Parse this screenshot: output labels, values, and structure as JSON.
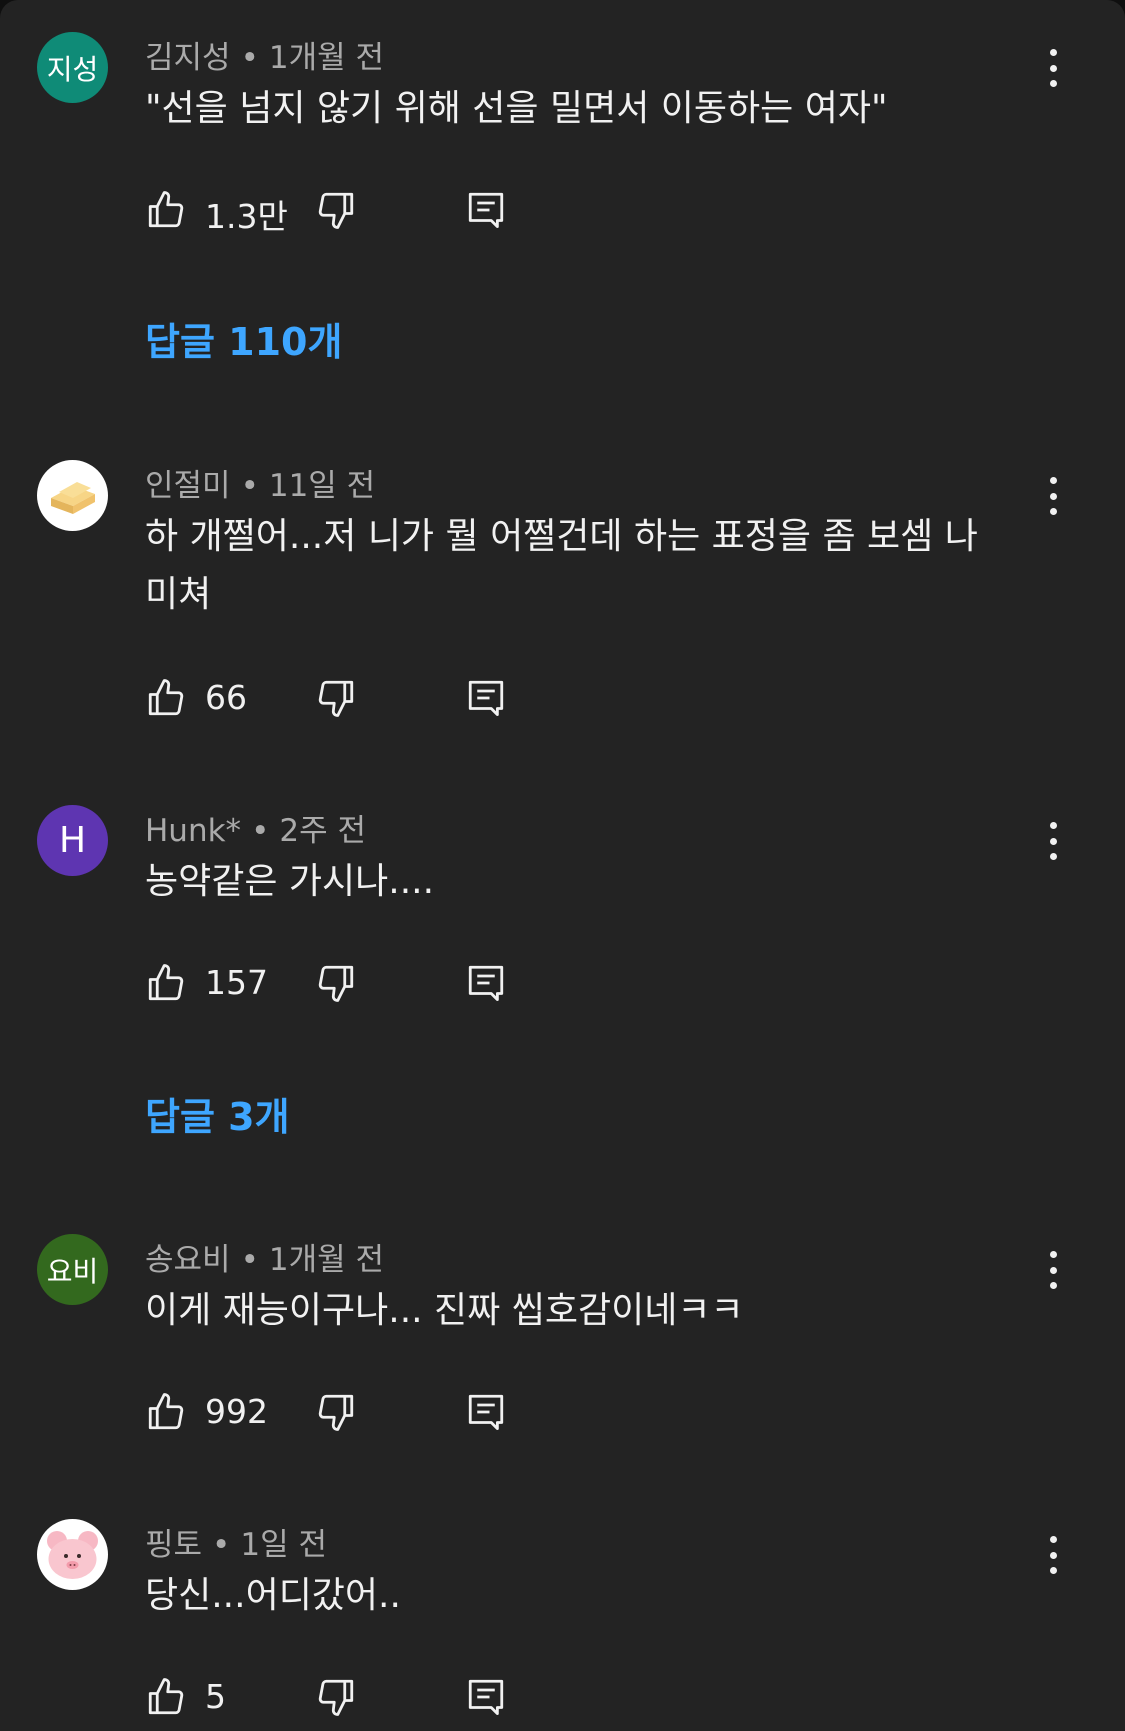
{
  "colors": {
    "background": "#232323",
    "text": "#f1f1f1",
    "meta": "#aaaaaa",
    "link": "#3ea6ff"
  },
  "comments": [
    {
      "avatar": {
        "text": "지성",
        "color": "#0f8b77"
      },
      "author": "김지성",
      "time": "1개월 전",
      "text": "\"선을 넘지 않기 위해 선을 밀면서 이동하는 여자\"",
      "likes": "1.3만",
      "replies": "답글 110개"
    },
    {
      "avatar": {
        "text": "",
        "icon": "cheese-icon",
        "color": "#ffffff"
      },
      "author": "인절미",
      "time": "11일 전",
      "text": "하 개쩔어...저 니가 뭘 어쩔건데 하는 표정을 좀 보셈 나 미쳐",
      "likes": "66"
    },
    {
      "avatar": {
        "text": "H",
        "color": "#5e35b1"
      },
      "author": "Hunk*",
      "time": "2주 전",
      "text": "농약같은 가시나....",
      "likes": "157",
      "replies": "답글 3개"
    },
    {
      "avatar": {
        "text": "요비",
        "color": "#33691e"
      },
      "author": "송요비",
      "time": "1개월 전",
      "text": "이게 재능이구나... 진짜 씹호감이네ㅋㅋ",
      "likes": "992"
    },
    {
      "avatar": {
        "text": "",
        "icon": "pig-icon",
        "color": "#ffffff"
      },
      "author": "핑토",
      "time": "1일 전",
      "text": "당신...어디갔어..",
      "likes": "5"
    }
  ]
}
